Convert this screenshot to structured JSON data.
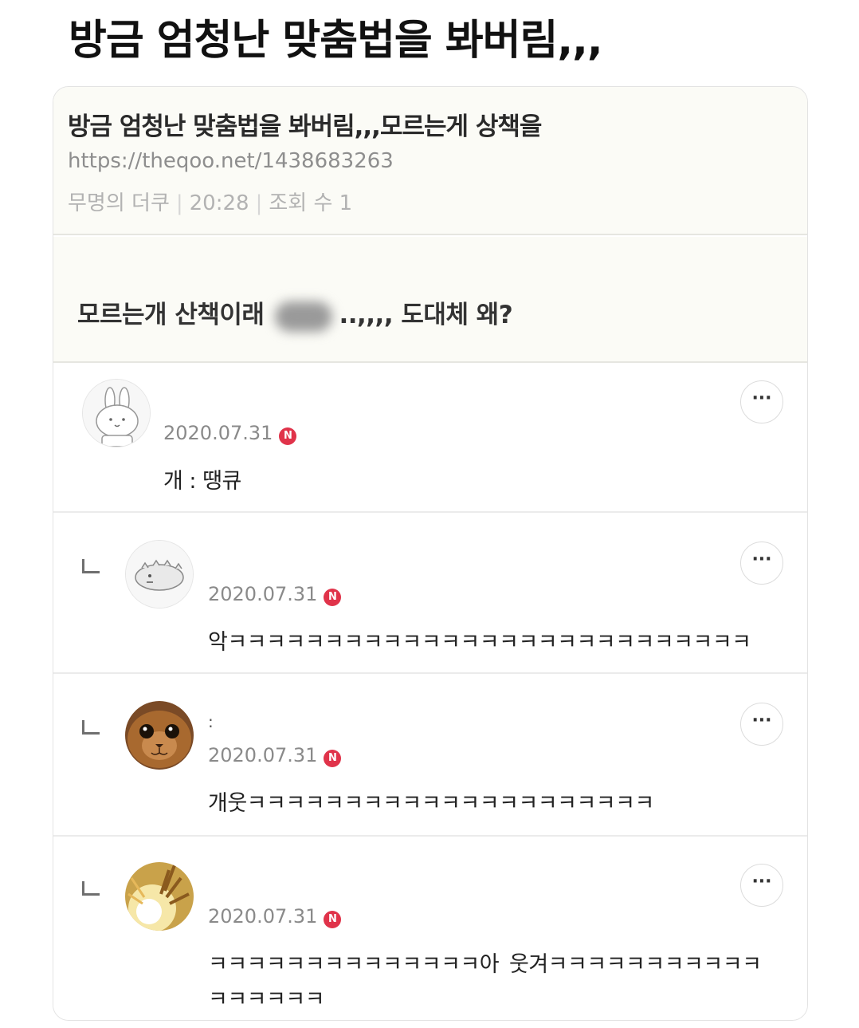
{
  "tweet": {
    "text": "방금 엄청난 맞춤법을 봐버림,,,"
  },
  "post": {
    "title": "방금 엄청난 맞춤법을 봐버림,,,모르는게 상책을",
    "url": "https://theqoo.net/1438683263",
    "author": "무명의 더쿠",
    "time": "20:28",
    "views": "조회 수 1",
    "body_before": "모르는개 산책이래",
    "body_after": "..,,,, 도대체 왜?"
  },
  "comments": [
    {
      "avatar": "rabbit-avatar",
      "name": "",
      "date": "2020.07.31",
      "badge": "N",
      "text": "개 : 땡큐",
      "more": "···"
    },
    {
      "avatar": "dino-avatar",
      "name": "",
      "date": "2020.07.31",
      "badge": "N",
      "text": "악ㅋㅋㅋㅋㅋㅋㅋㅋㅋㅋㅋㅋㅋㅋㅋㅋㅋㅋㅋㅋㅋㅋㅋㅋㅋㅋㅋ",
      "more": "···"
    },
    {
      "avatar": "cat-avatar",
      "name": ":",
      "date": "2020.07.31",
      "badge": "N",
      "text": "개웃ㅋㅋㅋㅋㅋㅋㅋㅋㅋㅋㅋㅋㅋㅋㅋㅋㅋㅋㅋㅋㅋ",
      "more": "···"
    },
    {
      "avatar": "burst-avatar",
      "name": "",
      "date": "2020.07.31",
      "badge": "N",
      "text_line1a": "ㅋㅋㅋㅋㅋㅋㅋㅋㅋㅋㅋㅋㅋㅋ아",
      "text_line1b": "웃겨ㅋㅋㅋㅋㅋㅋㅋㅋㅋㅋㅋ",
      "text_line2": "ㅋㅋㅋㅋㅋㅋ",
      "more": "···"
    }
  ]
}
